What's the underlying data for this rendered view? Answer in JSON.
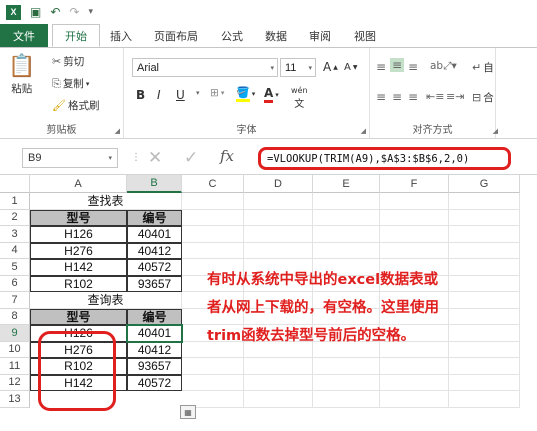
{
  "quick_access": {
    "logo": "X≣",
    "undo": "↶",
    "redo": "↷"
  },
  "tabs": [
    "文件",
    "开始",
    "插入",
    "页面布局",
    "公式",
    "数据",
    "审阅",
    "视图"
  ],
  "ribbon": {
    "clipboard": {
      "paste": "粘贴",
      "cut": "剪切",
      "copy": "复制",
      "format_painter": "格式刷",
      "title": "剪贴板"
    },
    "font": {
      "name": "Arial",
      "size": "11",
      "bold": "B",
      "italic": "I",
      "underline": "U",
      "title": "字体",
      "phonetic": "wén"
    },
    "align": {
      "wrap": "自",
      "merge": "合",
      "title": "对齐方式"
    }
  },
  "formula_bar": {
    "name_box": "B9",
    "fx": "fx",
    "formula": "=VLOOKUP(TRIM(A9),$A$3:$B$6,2,0)"
  },
  "columns": [
    "A",
    "B",
    "C",
    "D",
    "E",
    "F",
    "G"
  ],
  "rows": [
    "1",
    "2",
    "3",
    "4",
    "5",
    "6",
    "7",
    "8",
    "9",
    "10",
    "11",
    "12",
    "13"
  ],
  "cells": {
    "title1": "查找表",
    "hdr1_a": "型号",
    "hdr1_b": "编号",
    "t1": [
      [
        "H126",
        "40401"
      ],
      [
        "H276",
        "40412"
      ],
      [
        "H142",
        "40572"
      ],
      [
        "R102",
        "93657"
      ]
    ],
    "title2": "查询表",
    "hdr2_a": "型号",
    "hdr2_b": "编号",
    "t2": [
      [
        "H126",
        "40401"
      ],
      [
        "H276",
        "40412"
      ],
      [
        "R102",
        "93657"
      ],
      [
        "H142",
        "40572"
      ]
    ]
  },
  "annotation": [
    "有时从系统中导出的excel数据表或",
    "者从网上下载的，有空格。这里使用",
    "trim函数去掉型号前后的空格。"
  ],
  "colors": {
    "excel_green": "#217346",
    "highlight_red": "#e0201f"
  }
}
